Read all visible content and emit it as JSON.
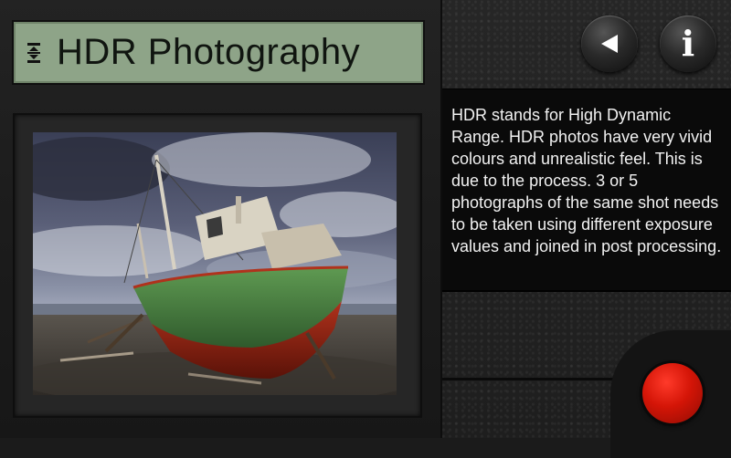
{
  "header": {
    "title": "HDR Photography",
    "title_icon": "expand-collapse-icon"
  },
  "buttons": {
    "back_icon": "back-arrow-icon",
    "info_icon": "info-icon",
    "info_glyph": "i",
    "record_icon": "record-icon"
  },
  "description": {
    "text": "HDR stands for High Dynamic Range. HDR photos have very vivid colours and unrealistic feel. This is due to the process. 3 or 5 photographs of the same shot needs to be taken using different exposure values and joined in post processing."
  },
  "colors": {
    "title_bar": "#8ea488",
    "record": "#d41507",
    "text": "#f2f2f2"
  }
}
